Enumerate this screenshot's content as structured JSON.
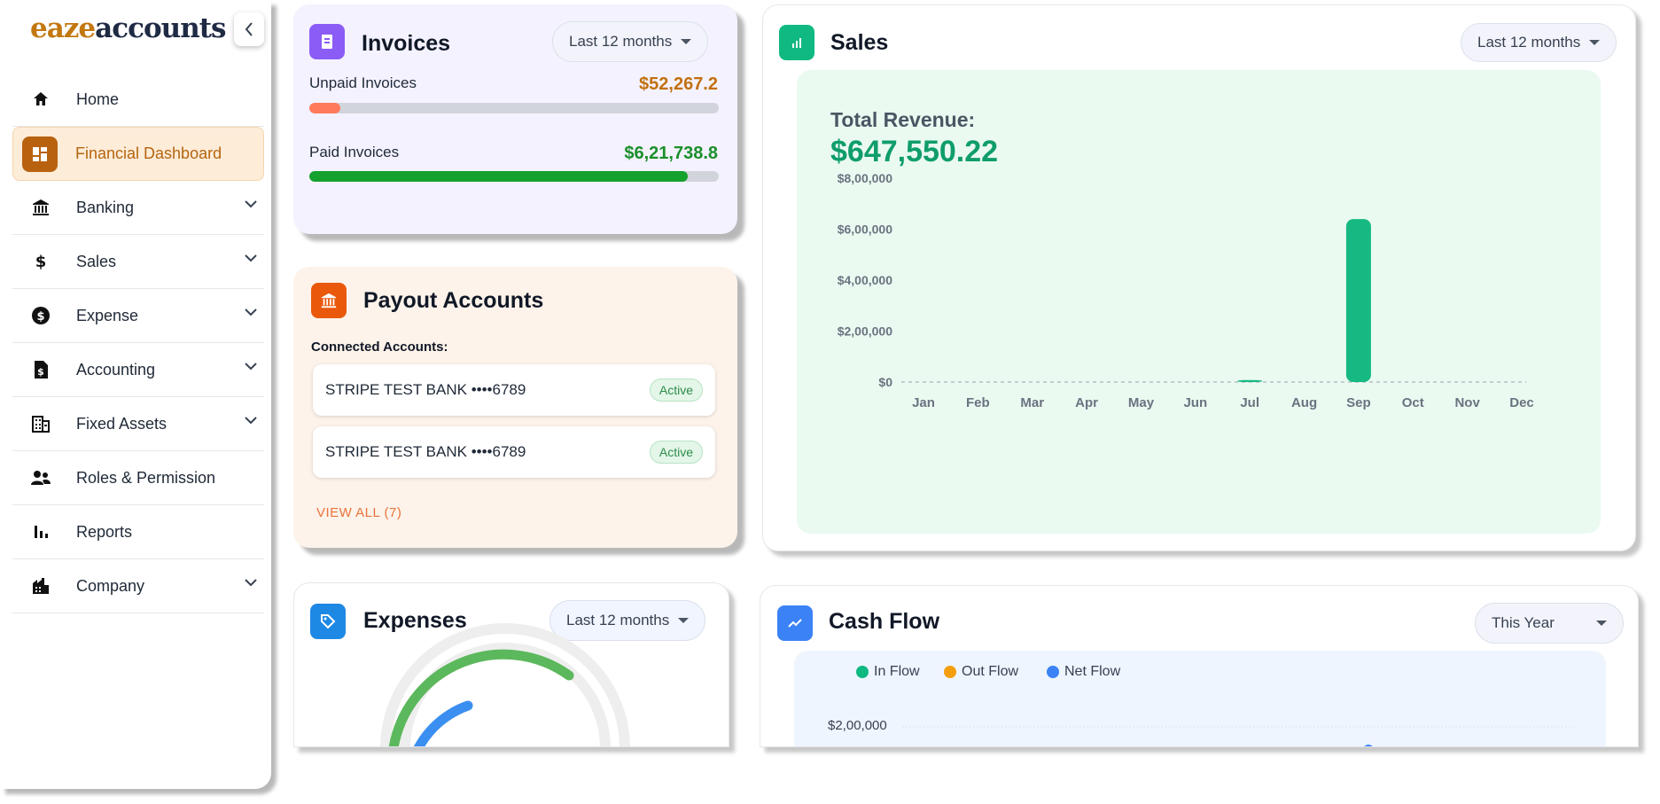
{
  "brand": {
    "part1": "eaze",
    "part2": "accounts"
  },
  "sidebar": {
    "items": [
      {
        "label": "Home",
        "icon": "home-icon",
        "expandable": false,
        "active": false
      },
      {
        "label": "Financial Dashboard",
        "icon": "dashboard-icon",
        "expandable": false,
        "active": true
      },
      {
        "label": "Banking",
        "icon": "bank-icon",
        "expandable": true,
        "active": false
      },
      {
        "label": "Sales",
        "icon": "dollar-icon",
        "expandable": true,
        "active": false
      },
      {
        "label": "Expense",
        "icon": "coin-icon",
        "expandable": true,
        "active": false
      },
      {
        "label": "Accounting",
        "icon": "document-dollar-icon",
        "expandable": true,
        "active": false
      },
      {
        "label": "Fixed Assets",
        "icon": "building-icon",
        "expandable": true,
        "active": false
      },
      {
        "label": "Roles & Permission",
        "icon": "people-icon",
        "expandable": false,
        "active": false
      },
      {
        "label": "Reports",
        "icon": "bar-chart-icon",
        "expandable": false,
        "active": false
      },
      {
        "label": "Company",
        "icon": "company-icon",
        "expandable": true,
        "active": false
      }
    ]
  },
  "invoices": {
    "title": "Invoices",
    "period": "Last 12 months",
    "unpaid_label": "Unpaid Invoices",
    "unpaid_value": "$52,267.2",
    "unpaid_fraction": 0.076,
    "paid_label": "Paid Invoices",
    "paid_value": "$6,21,738.8",
    "paid_fraction": 0.925,
    "colors": {
      "unpaid": "#ff7a5a",
      "paid": "#14a12e",
      "unpaid_text": "#c2700f",
      "paid_text": "#1a8f2a"
    }
  },
  "payout": {
    "title": "Payout Accounts",
    "connected_label": "Connected Accounts:",
    "accounts": [
      {
        "name": "STRIPE TEST BANK ••••6789",
        "status": "Active"
      },
      {
        "name": "STRIPE TEST BANK ••••6789",
        "status": "Active"
      }
    ],
    "view_all": "VIEW ALL (7)"
  },
  "sales": {
    "title": "Sales",
    "period": "Last 12 months",
    "revenue_label": "Total Revenue:",
    "revenue_value": "$647,550.22"
  },
  "chart_data": [
    {
      "type": "bar",
      "title": "",
      "categories": [
        "Jan",
        "Feb",
        "Mar",
        "Apr",
        "May",
        "Jun",
        "Jul",
        "Aug",
        "Sep",
        "Oct",
        "Nov",
        "Dec"
      ],
      "values": [
        0,
        0,
        0,
        0,
        0,
        0,
        8000,
        0,
        639550,
        0,
        0,
        0
      ],
      "ylim": [
        0,
        800000
      ],
      "yticks": [
        0,
        200000,
        400000,
        600000,
        800000
      ],
      "ytick_labels": [
        "$0",
        "$2,00,000",
        "$4,00,000",
        "$6,00,000",
        "$8,00,000"
      ],
      "color": "#16b981",
      "grid": "dashed baseline"
    },
    {
      "type": "line",
      "title": "",
      "series": [
        {
          "name": "In Flow",
          "color": "#10b981"
        },
        {
          "name": "Out Flow",
          "color": "#f59e0b"
        },
        {
          "name": "Net Flow",
          "color": "#3b82f6"
        }
      ],
      "visible_ytick_labels": [
        "$2,00,000"
      ],
      "legend_position": "top-left"
    }
  ],
  "expenses": {
    "title": "Expenses",
    "period": "Last 12 months"
  },
  "cashflow": {
    "title": "Cash Flow",
    "period": "This Year",
    "legend": [
      "In Flow",
      "Out Flow",
      "Net Flow"
    ],
    "ytick": "$2,00,000"
  }
}
